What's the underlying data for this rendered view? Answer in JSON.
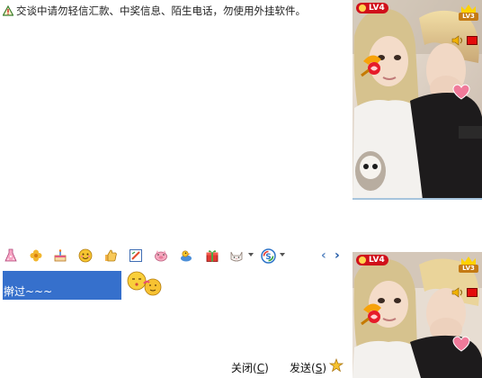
{
  "warning": {
    "text": "交谈中请勿轻信汇款、中奖信息、陌生电话，勿使用外挂软件。",
    "icon": "warning-triangle-icon"
  },
  "video_top": {
    "level_badge": "LV4",
    "crown_level": "LV3"
  },
  "video_bottom": {
    "level_badge": "LV4",
    "crown_level": "LV3"
  },
  "toolbar": {
    "icons": [
      "dress-icon",
      "clover-icon",
      "cake-icon",
      "face-icon",
      "thumbs-up-icon",
      "doodle-icon",
      "pig-icon",
      "duck-icon",
      "gift-icon",
      "cat-icon",
      "soso-search-icon"
    ],
    "prev_arrow": "‹",
    "next_arrow": "›"
  },
  "input": {
    "selected_text": "擀过~~~"
  },
  "buttons": {
    "close_label": "关闭(",
    "close_key": "C",
    "close_tail": ")",
    "send_label": "发送(",
    "send_key": "S",
    "send_tail": ")"
  },
  "colors": {
    "selection": "#3670cc",
    "badge": "#d0101a",
    "video_border": "#a6c4dc"
  }
}
